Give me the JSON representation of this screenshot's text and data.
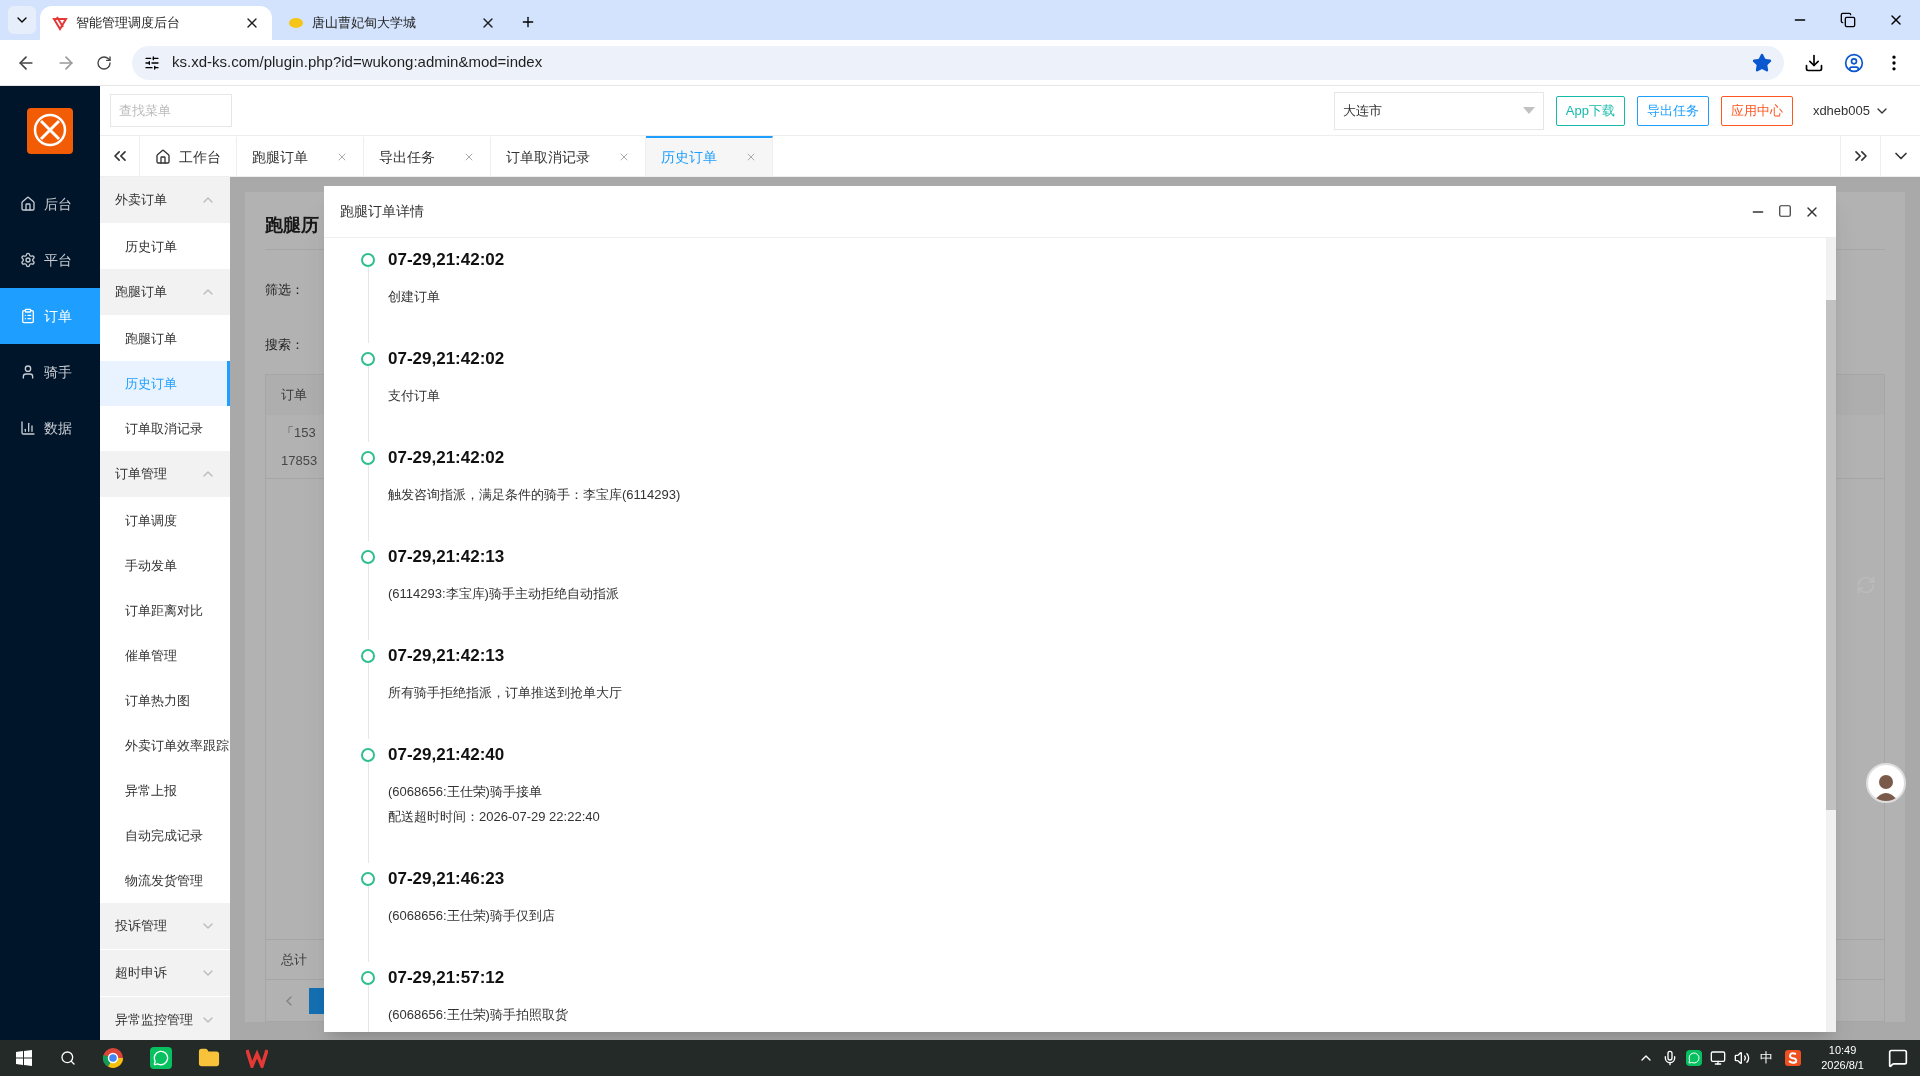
{
  "browser": {
    "tabs": [
      {
        "title": "智能管理调度后台",
        "selected": true
      },
      {
        "title": "唐山曹妃甸大学城",
        "selected": false
      }
    ],
    "url": "ks.xd-ks.com/plugin.php?id=wukong:admin&mod=index"
  },
  "header": {
    "search": {
      "placeholder": "查找菜单"
    },
    "city": "大连市",
    "buttons": [
      {
        "label": "App下载",
        "color": "#16baaa"
      },
      {
        "label": "导出任务",
        "color": "#1e9fff"
      },
      {
        "label": "应用中心",
        "color": "#ff5722"
      }
    ],
    "user": "xdheb005"
  },
  "nav": [
    {
      "label": "后台",
      "kind": "home",
      "selected": false
    },
    {
      "label": "平台",
      "kind": "settings",
      "selected": false
    },
    {
      "label": "订单",
      "kind": "order",
      "selected": true
    },
    {
      "label": "骑手",
      "kind": "rider",
      "selected": false
    },
    {
      "label": "数据",
      "kind": "data",
      "selected": false
    }
  ],
  "menu": [
    {
      "title": "外卖订单",
      "expanded": true,
      "items": [
        {
          "label": "历史订单",
          "selected": false
        }
      ]
    },
    {
      "title": "跑腿订单",
      "expanded": true,
      "items": [
        {
          "label": "跑腿订单",
          "selected": false
        },
        {
          "label": "历史订单",
          "selected": true
        },
        {
          "label": "订单取消记录",
          "selected": false
        }
      ]
    },
    {
      "title": "订单管理",
      "expanded": true,
      "items": [
        {
          "label": "订单调度",
          "selected": false
        },
        {
          "label": "手动发单",
          "selected": false
        },
        {
          "label": "订单距离对比",
          "selected": false
        },
        {
          "label": "催单管理",
          "selected": false
        },
        {
          "label": "订单热力图",
          "selected": false
        },
        {
          "label": "外卖订单效率跟踪",
          "selected": false
        },
        {
          "label": "异常上报",
          "selected": false
        },
        {
          "label": "自动完成记录",
          "selected": false
        },
        {
          "label": "物流发货管理",
          "selected": false
        }
      ]
    },
    {
      "title": "投诉管理",
      "expanded": false
    },
    {
      "title": "超时申诉",
      "expanded": false
    },
    {
      "title": "异常监控管理",
      "expanded": false
    }
  ],
  "page_tabs": [
    {
      "label": "工作台",
      "kind": "home",
      "selected": false
    },
    {
      "label": "跑腿订单",
      "kind": "closable",
      "selected": false
    },
    {
      "label": "导出任务",
      "kind": "closable",
      "selected": false
    },
    {
      "label": "订单取消记录",
      "kind": "closable",
      "selected": false
    },
    {
      "label": "历史订单",
      "kind": "closable",
      "selected": true
    }
  ],
  "background": {
    "title": "跑腿历",
    "filter_label": "筛选：",
    "search_label": "搜索：",
    "column_1": "订单",
    "cells": [
      "「153",
      "17853"
    ],
    "total_label": "总计"
  },
  "modal": {
    "title": "跑腿订单详情",
    "events": [
      {
        "time": "07-29,21:42:02",
        "lines": [
          "创建订单"
        ]
      },
      {
        "time": "07-29,21:42:02",
        "lines": [
          "支付订单"
        ]
      },
      {
        "time": "07-29,21:42:02",
        "lines": [
          "触发咨询指派，满足条件的骑手：李宝库(6114293)"
        ]
      },
      {
        "time": "07-29,21:42:13",
        "lines": [
          "(6114293:李宝库)骑手主动拒绝自动指派"
        ]
      },
      {
        "time": "07-29,21:42:13",
        "lines": [
          "所有骑手拒绝指派，订单推送到抢单大厅"
        ]
      },
      {
        "time": "07-29,21:42:40",
        "lines": [
          "(6068656:王仕荣)骑手接单",
          "配送超时时间：2026-07-29 22:22:40"
        ]
      },
      {
        "time": "07-29,21:46:23",
        "lines": [
          "(6068656:王仕荣)骑手仅到店"
        ]
      },
      {
        "time": "07-29,21:57:12",
        "lines": [
          "(6068656:王仕荣)骑手拍照取货"
        ]
      }
    ]
  },
  "taskbar": {
    "ime": "中",
    "time": "10:49",
    "date": "2026/8/1"
  }
}
